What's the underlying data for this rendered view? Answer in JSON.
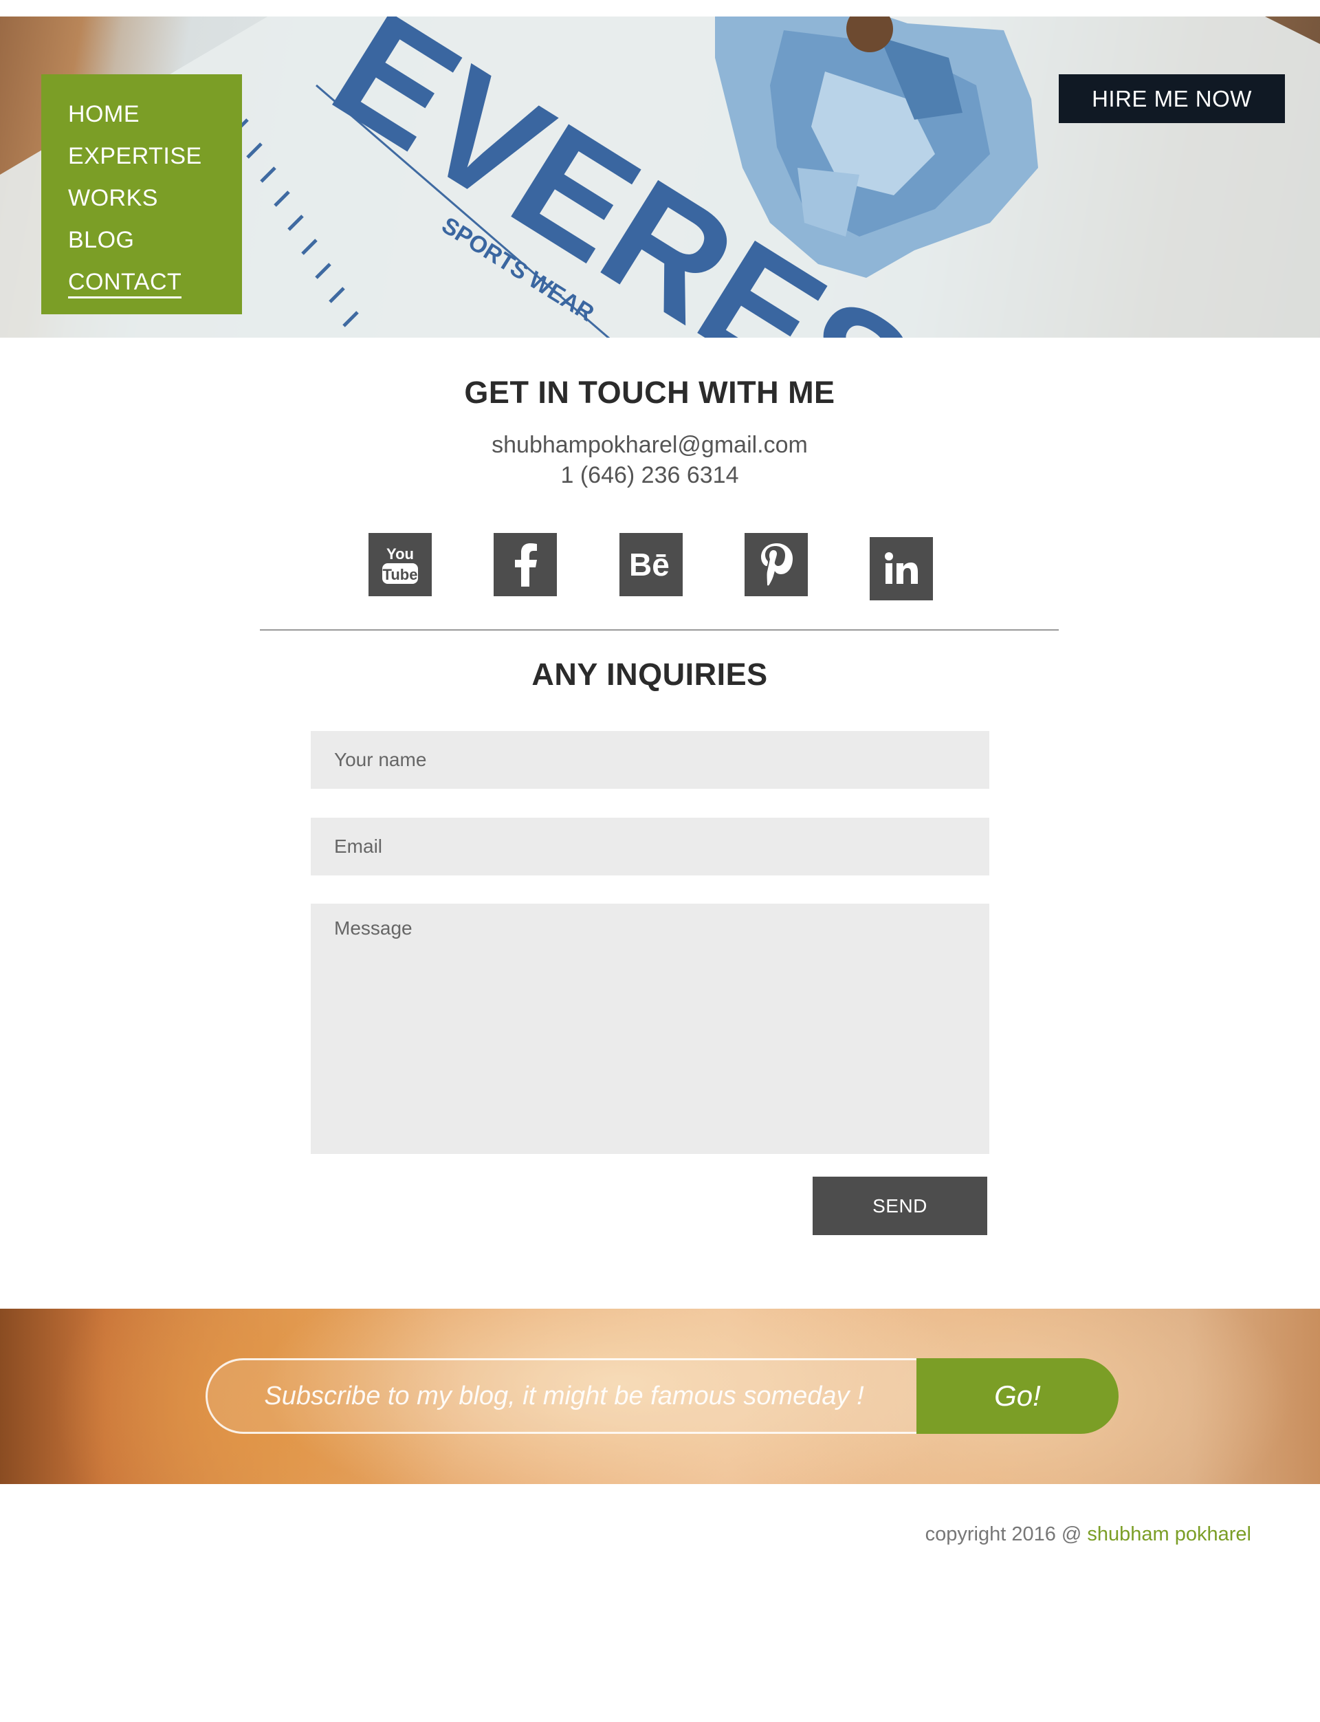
{
  "hero": {
    "nav": [
      {
        "label": "HOME",
        "active": false
      },
      {
        "label": "EXPERTISE",
        "active": false
      },
      {
        "label": "WORKS",
        "active": false
      },
      {
        "label": "BLOG",
        "active": false
      },
      {
        "label": "CONTACT",
        "active": true
      }
    ],
    "hire_label": "HIRE ME NOW",
    "tag_brand": "EVEREST",
    "tag_sub": "SPORTS WEAR"
  },
  "contact": {
    "title": "GET IN TOUCH WITH ME",
    "email": "shubhampokharel@gmail.com",
    "phone": "1 (646) 236 6314",
    "social": [
      {
        "name": "youtube",
        "icon": "youtube-icon"
      },
      {
        "name": "facebook",
        "icon": "facebook-icon"
      },
      {
        "name": "behance",
        "icon": "behance-icon"
      },
      {
        "name": "pinterest",
        "icon": "pinterest-icon"
      },
      {
        "name": "linkedin",
        "icon": "linkedin-icon"
      }
    ]
  },
  "inquiries": {
    "title": "ANY INQUIRIES",
    "name_placeholder": "Your name",
    "email_placeholder": "Email",
    "message_placeholder": "Message",
    "send_label": "SEND"
  },
  "subscribe": {
    "placeholder": "Subscribe to my blog, it might be famous someday !",
    "go_label": "Go!"
  },
  "footer": {
    "prefix": "copyright 2016 @ ",
    "author": "shubham pokharel"
  },
  "colors": {
    "accent_green": "#7b9e26",
    "hire_bg": "#101924",
    "icon_bg": "#4d4d4d",
    "field_bg": "#ebebeb"
  }
}
